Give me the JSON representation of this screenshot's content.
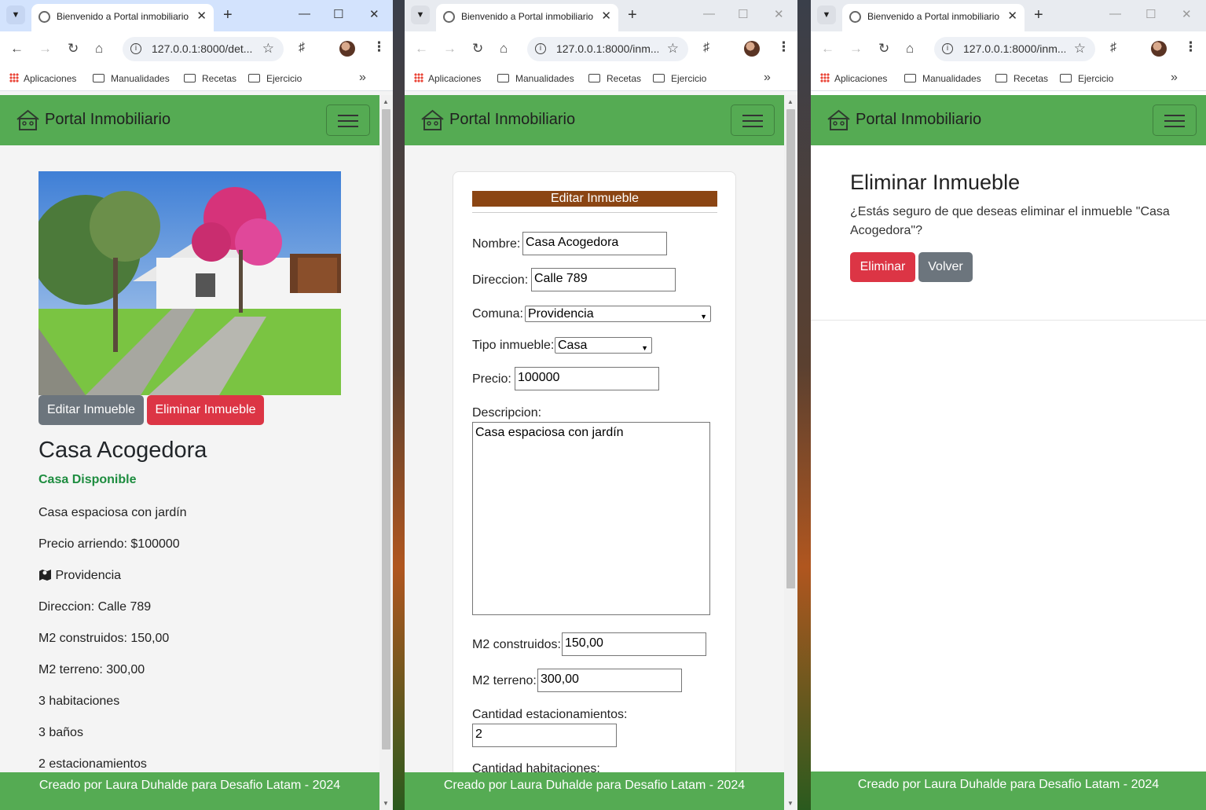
{
  "browser": {
    "tab_title": "Bienvenido a Portal inmobiliario",
    "bookmarks": [
      "Aplicaciones",
      "Manualidades",
      "Recetas",
      "Ejercicio"
    ],
    "url_detail": "127.0.0.1:8000/det...",
    "url_edit": "127.0.0.1:8000/inm...",
    "url_delete": "127.0.0.1:8000/inm..."
  },
  "site": {
    "brand": "Portal Inmobiliario",
    "footer": "Creado por Laura Duhalde para Desafio Latam - 2024",
    "navbar_color": "#55ab53"
  },
  "detail": {
    "edit_button": "Editar Inmueble",
    "delete_button": "Eliminar Inmueble",
    "title": "Casa Acogedora",
    "status": "Casa Disponible",
    "description": "Casa espaciosa con jardín",
    "price": "Precio arriendo: $100000",
    "comuna": "Providencia",
    "address": "Direccion: Calle 789",
    "m2_built": "M2 construidos: 150,00",
    "m2_land": "M2 terreno: 300,00",
    "rooms": "3 habitaciones",
    "baths": "3 baños",
    "parking": "2 estacionamientos"
  },
  "edit_form": {
    "heading": "Editar Inmueble",
    "nombre_label": "Nombre:",
    "nombre_value": "Casa Acogedora",
    "direccion_label": "Direccion:",
    "direccion_value": "Calle 789",
    "comuna_label": "Comuna:",
    "comuna_value": "Providencia",
    "tipo_label": "Tipo inmueble:",
    "tipo_value": "Casa",
    "precio_label": "Precio:",
    "precio_value": "100000",
    "descripcion_label": "Descripcion:",
    "descripcion_value": "Casa espaciosa con jardín",
    "m2_construidos_label": "M2 construidos:",
    "m2_construidos_value": "150,00",
    "m2_terreno_label": "M2 terreno:",
    "m2_terreno_value": "300,00",
    "estacionamientos_label": "Cantidad estacionamientos:",
    "estacionamientos_value": "2",
    "habitaciones_label": "Cantidad habitaciones:"
  },
  "delete_page": {
    "title": "Eliminar Inmueble",
    "message": "¿Estás seguro de que deseas eliminar el inmueble \"Casa Acogedora\"?",
    "confirm_button": "Eliminar",
    "back_button": "Volver"
  },
  "icons": {
    "brand": "house-icon",
    "comuna": "map-icon"
  }
}
